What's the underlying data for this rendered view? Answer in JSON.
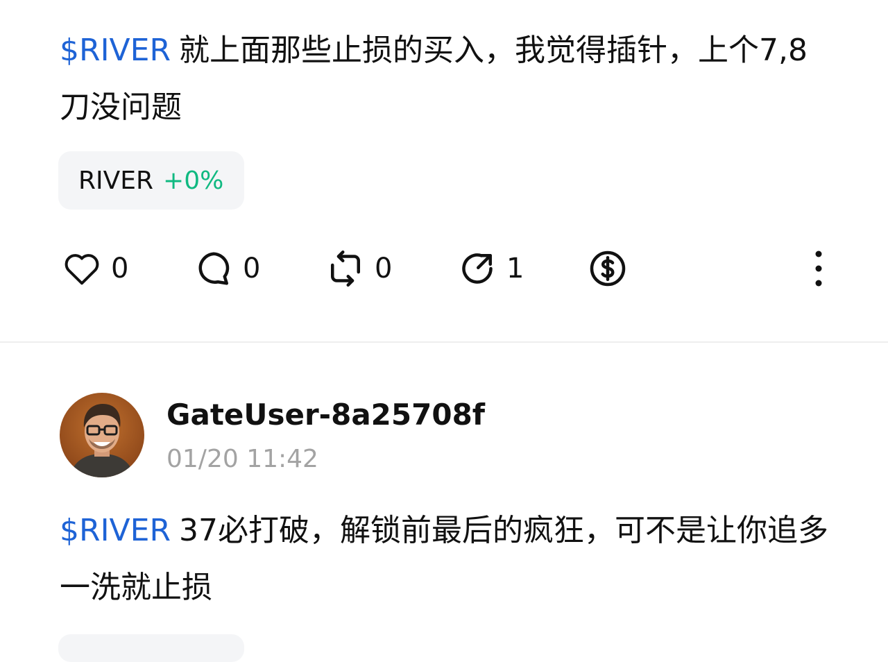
{
  "posts": [
    {
      "cashtag": "$RIVER",
      "text": "就上面那些止损的买入，我觉得插针，上个7,8刀没问题",
      "token": {
        "symbol": "RIVER",
        "change": "+0%"
      },
      "actions": {
        "likes": "0",
        "comments": "0",
        "reposts": "0",
        "shares": "1"
      }
    },
    {
      "author": "GateUser-8a25708f",
      "time": "01/20 11:42",
      "cashtag": "$RIVER",
      "text": "37必打破，解锁前最后的疯狂，可不是让你追多一洗就止损"
    }
  ],
  "colors": {
    "cashtag": "#1e63d6",
    "positive": "#10b981",
    "muted": "#a3a3a3"
  },
  "icons": [
    "heart-icon",
    "comment-icon",
    "repost-icon",
    "share-icon",
    "tip-dollar-icon",
    "more-vertical-icon"
  ]
}
